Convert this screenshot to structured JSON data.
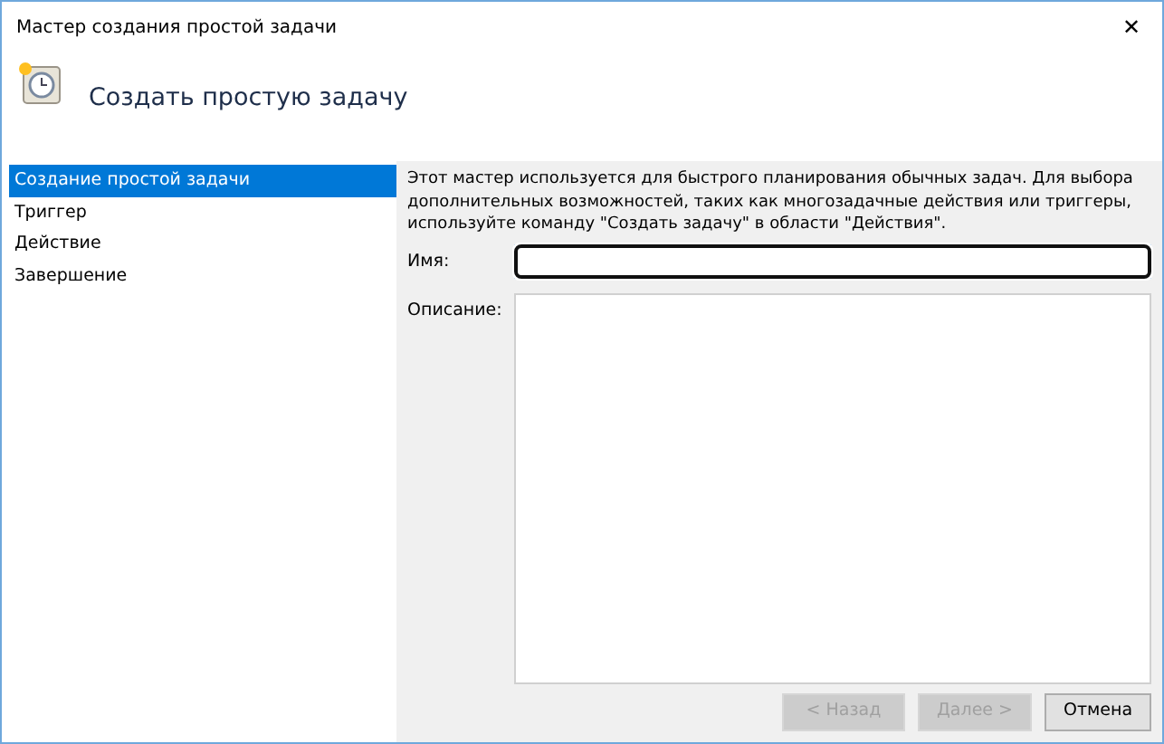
{
  "window": {
    "title": "Мастер создания простой задачи",
    "close": "✕"
  },
  "header": {
    "title": "Создать простую задачу"
  },
  "sidebar": {
    "items": [
      {
        "label": "Создание простой задачи",
        "selected": true
      },
      {
        "label": "Триггер",
        "selected": false
      },
      {
        "label": "Действие",
        "selected": false
      },
      {
        "label": "Завершение",
        "selected": false
      }
    ]
  },
  "intro_lines": [
    "Этот мастер используется для быстрого планирования обычных задач.  Для выбора",
    "дополнительных возможностей, таких как многозадачные действия или триггеры,",
    "используйте команду \"Создать задачу\" в области \"Действия\"."
  ],
  "fields": [
    {
      "label": "Имя:",
      "kind": "input",
      "focused": true
    },
    {
      "label": "Описание:",
      "kind": "textarea",
      "focused": false
    }
  ],
  "buttons": [
    {
      "label": "< Назад",
      "disabled": true
    },
    {
      "label": "Далее >",
      "disabled": true
    },
    {
      "label": "Отмена",
      "disabled": false
    }
  ]
}
